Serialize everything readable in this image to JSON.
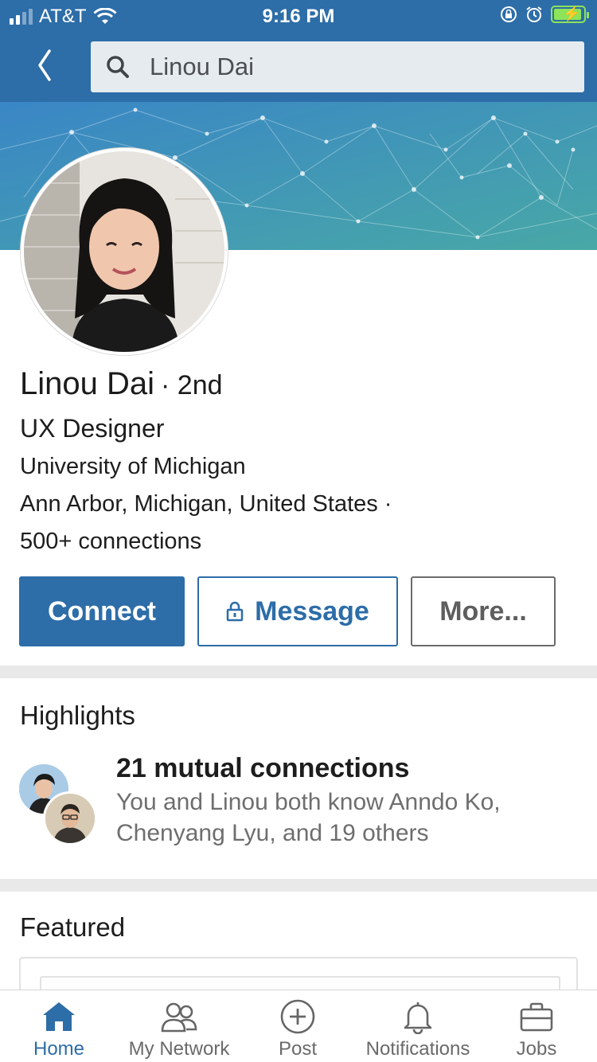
{
  "status_bar": {
    "carrier": "AT&T",
    "time": "9:16 PM"
  },
  "search": {
    "value": "Linou Dai"
  },
  "profile": {
    "name": "Linou Dai",
    "degree": "· 2nd",
    "headline": "UX Designer",
    "school": "University of Michigan",
    "location": "Ann Arbor, Michigan, United States ·",
    "connections": "500+ connections"
  },
  "actions": {
    "connect_label": "Connect",
    "message_label": "Message",
    "more_label": "More..."
  },
  "highlights": {
    "title": "Highlights",
    "mutual_title": "21 mutual connections",
    "mutual_desc": "You and Linou both know Anndo Ko, Chenyang Lyu, and 19 others"
  },
  "featured": {
    "title": "Featured"
  },
  "bottom_nav": {
    "items": [
      {
        "label": "Home",
        "icon": "home-icon",
        "active": true
      },
      {
        "label": "My Network",
        "icon": "network-icon",
        "active": false
      },
      {
        "label": "Post",
        "icon": "post-icon",
        "active": false
      },
      {
        "label": "Notifications",
        "icon": "bell-icon",
        "active": false
      },
      {
        "label": "Jobs",
        "icon": "briefcase-icon",
        "active": false
      }
    ]
  },
  "colors": {
    "brand_blue": "#2d6da8",
    "banner_start": "#3b88c4",
    "banner_end": "#47a7a9"
  }
}
